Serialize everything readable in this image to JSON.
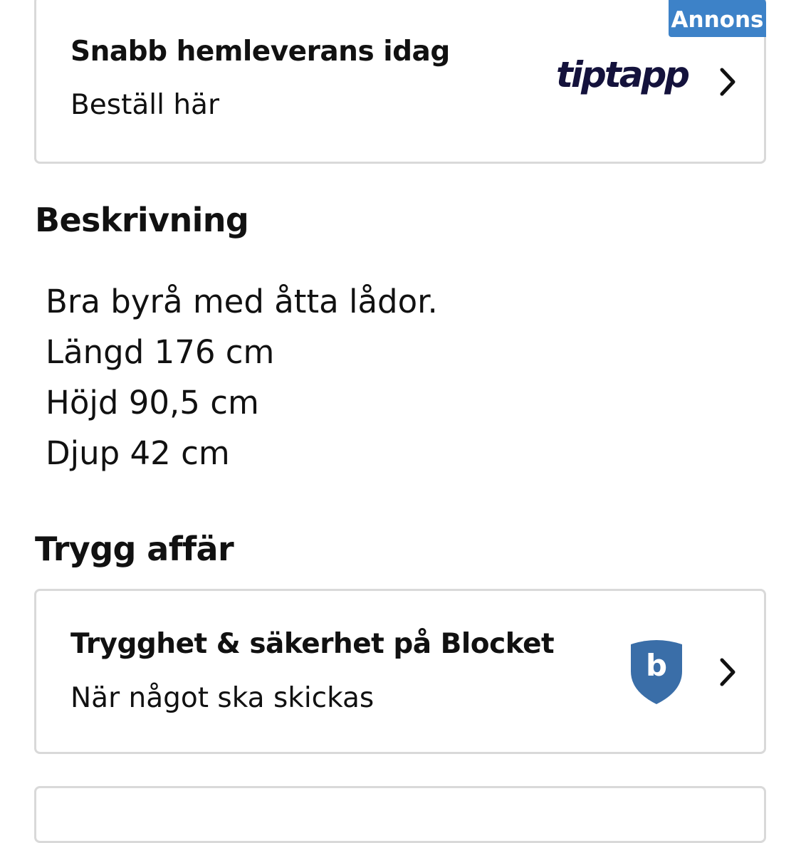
{
  "ad_card": {
    "badge": "Annons",
    "title": "Snabb hemleverans idag",
    "subtitle": "Beställ här",
    "logo_text": "tiptapp",
    "logo_color": "#14123c",
    "icon": "chevron-right-icon"
  },
  "description": {
    "heading": "Beskrivning",
    "lines": [
      "Bra byrå med åtta lådor.",
      "Längd 176 cm",
      "Höjd 90,5 cm",
      "Djup 42 cm"
    ]
  },
  "safety": {
    "heading": "Trygg affär",
    "card": {
      "title": "Trygghet & säkerhet på Blocket",
      "subtitle": "När något ska skickas",
      "shield_letter": "b",
      "shield_icon": "blocket-shield-icon",
      "shield_color": "#3a6ea8",
      "icon": "chevron-right-icon"
    }
  },
  "colors": {
    "accent": "#3d82c8",
    "border": "#d9d9d9",
    "text": "#111111"
  }
}
